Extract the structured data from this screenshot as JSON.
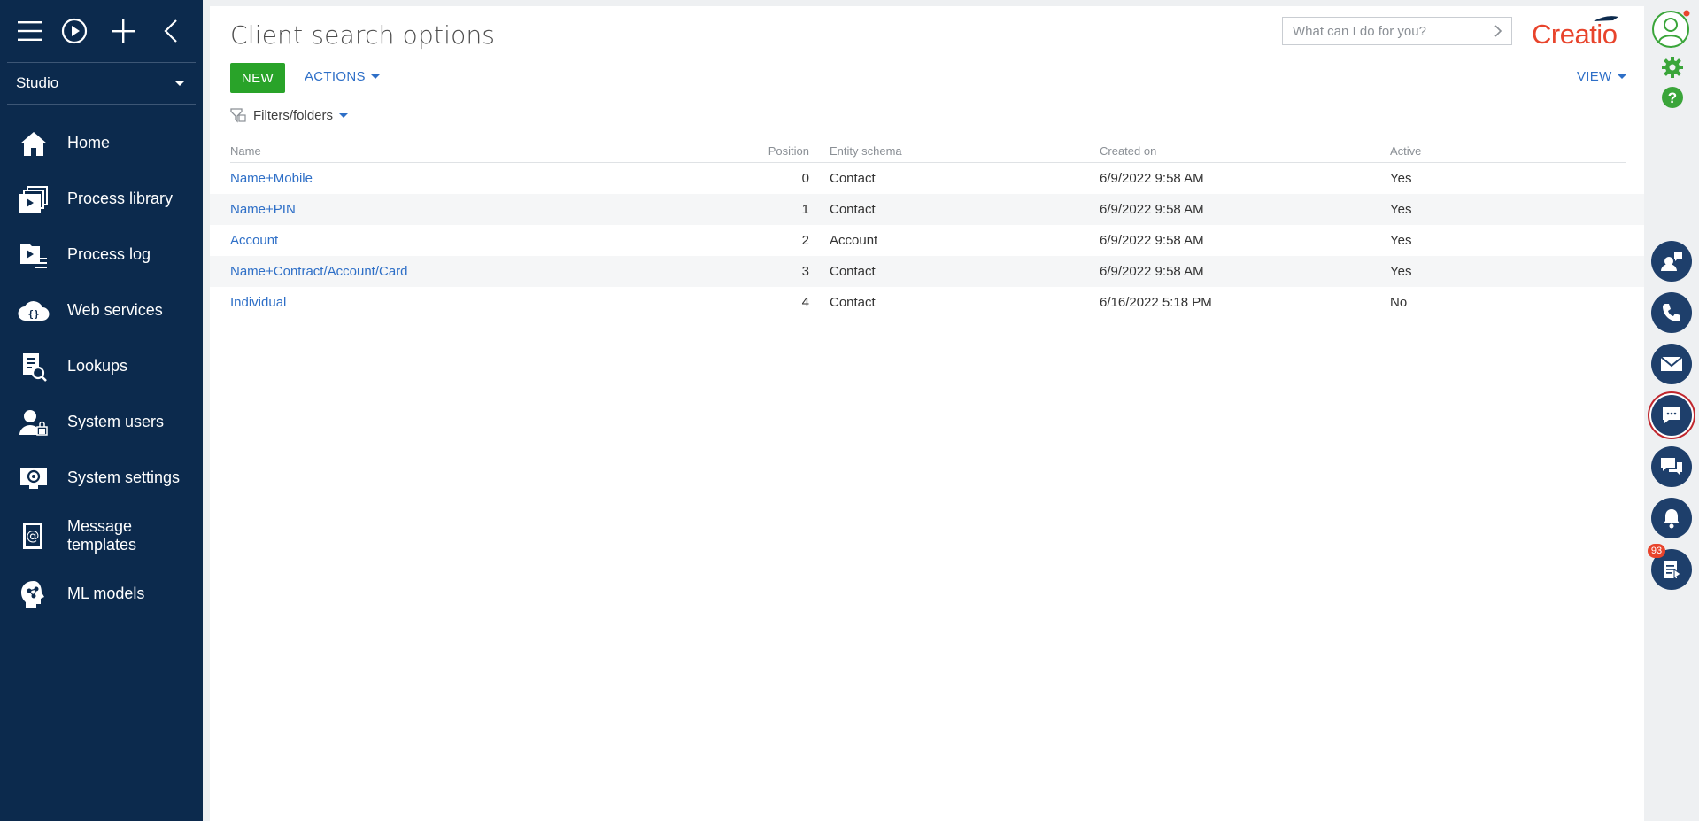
{
  "sidebar": {
    "workplace": "Studio",
    "items": [
      {
        "label": "Home",
        "icon": "home-icon"
      },
      {
        "label": "Process library",
        "icon": "process-library-icon"
      },
      {
        "label": "Process log",
        "icon": "process-log-icon"
      },
      {
        "label": "Web services",
        "icon": "web-services-icon"
      },
      {
        "label": "Lookups",
        "icon": "lookups-icon"
      },
      {
        "label": "System users",
        "icon": "system-users-icon"
      },
      {
        "label": "System settings",
        "icon": "system-settings-icon"
      },
      {
        "label": "Message templates",
        "icon": "message-templates-icon"
      },
      {
        "label": "ML models",
        "icon": "ml-models-icon"
      }
    ]
  },
  "header": {
    "title": "Client search options",
    "search_placeholder": "What can I do for you?",
    "logo_text": "Creatio"
  },
  "toolbar": {
    "new_label": "NEW",
    "actions_label": "ACTIONS",
    "view_label": "VIEW",
    "filters_label": "Filters/folders"
  },
  "grid": {
    "columns": [
      "Name",
      "Position",
      "Entity schema",
      "Created on",
      "Active"
    ],
    "rows": [
      {
        "name": "Name+Mobile",
        "position": "0",
        "entity": "Contact",
        "created": "6/9/2022 9:58 AM",
        "active": "Yes"
      },
      {
        "name": "Name+PIN",
        "position": "1",
        "entity": "Contact",
        "created": "6/9/2022 9:58 AM",
        "active": "Yes"
      },
      {
        "name": "Account",
        "position": "2",
        "entity": "Account",
        "created": "6/9/2022 9:58 AM",
        "active": "Yes"
      },
      {
        "name": "Name+Contract/Account/Card",
        "position": "3",
        "entity": "Contact",
        "created": "6/9/2022 9:58 AM",
        "active": "Yes"
      },
      {
        "name": "Individual",
        "position": "4",
        "entity": "Contact",
        "created": "6/16/2022 5:18 PM",
        "active": "No"
      }
    ]
  },
  "right_panel": {
    "notification_count": "93"
  },
  "colors": {
    "sidebar_bg": "#0c2a4d",
    "accent_green": "#29a329",
    "link_blue": "#2e6fc7",
    "brand_red": "#e8442c",
    "panel_button": "#1e3f6b"
  }
}
